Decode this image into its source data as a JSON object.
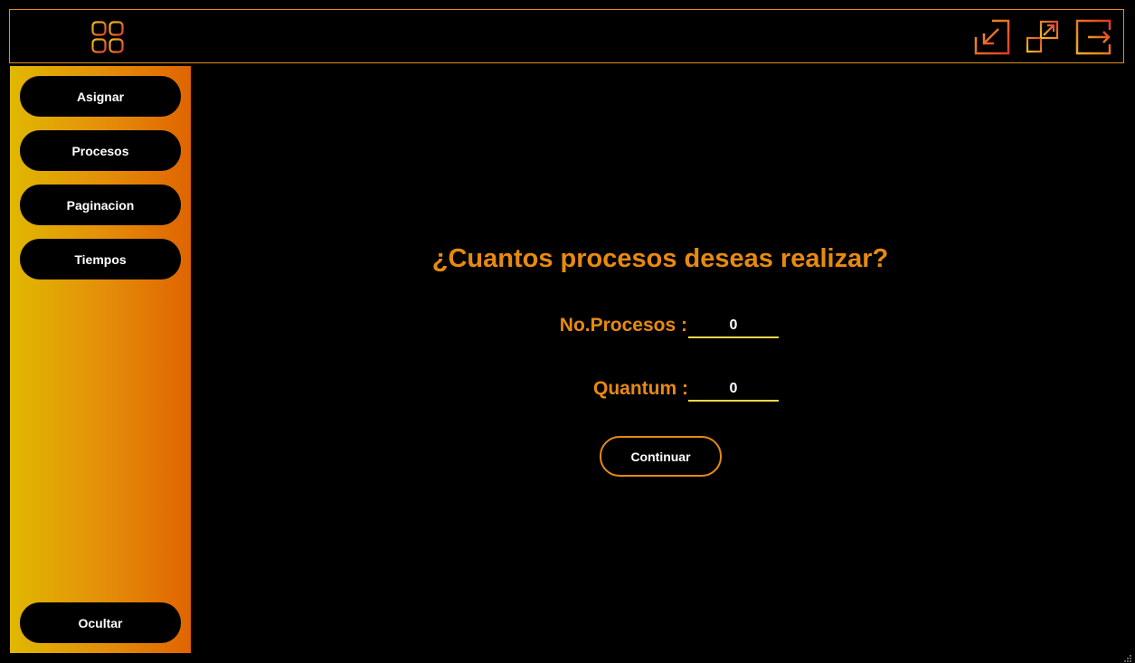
{
  "window": {
    "icons": {
      "menu": "grid-menu-icon",
      "minimize": "minimize-arrow-icon",
      "restore": "restore-window-icon",
      "close": "exit-icon"
    },
    "colors": {
      "accent": "#e88a10",
      "border": "#e0901a",
      "sidebar_gradient_start": "#e0b800",
      "sidebar_gradient_end": "#e06400",
      "input_underline": "#f2d84a",
      "background": "#000000"
    }
  },
  "sidebar": {
    "items": [
      {
        "label": "Asignar"
      },
      {
        "label": "Procesos"
      },
      {
        "label": "Paginacion"
      },
      {
        "label": "Tiempos"
      }
    ],
    "hide_label": "Ocultar"
  },
  "main": {
    "question": "¿Cuantos procesos deseas realizar?",
    "fields": {
      "procesos": {
        "label": "No.Procesos :",
        "value": "0"
      },
      "quantum": {
        "label": "Quantum :",
        "value": "0"
      }
    },
    "continue_label": "Continuar"
  }
}
